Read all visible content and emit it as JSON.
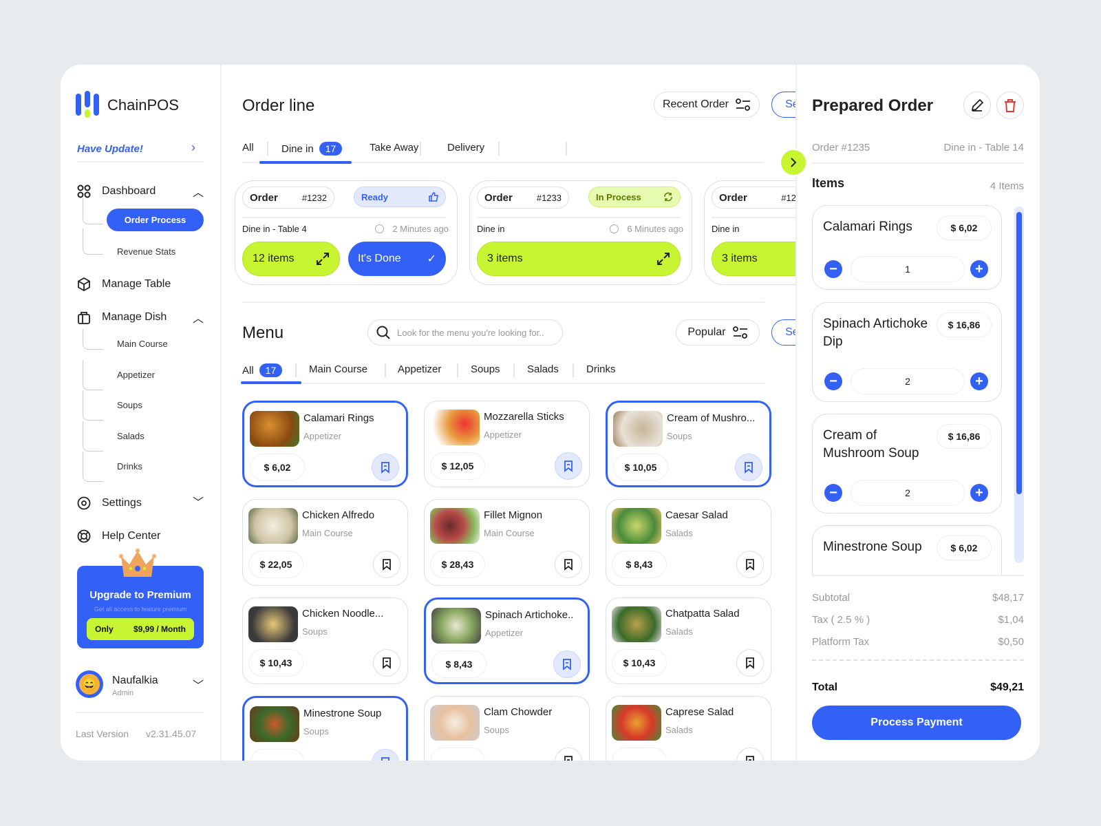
{
  "brand": {
    "name": "ChainPOS",
    "accent": "#3461f5",
    "lime": "#c8f531"
  },
  "sidebar": {
    "update": "Have Update!",
    "dashboard": "Dashboard",
    "dashboard_sub": [
      "Order Process",
      "Revenue Stats"
    ],
    "manage_table": "Manage Table",
    "manage_dish": "Manage Dish",
    "dish_sub": [
      "Main Course",
      "Appetizer",
      "Soups",
      "Salads",
      "Drinks"
    ],
    "settings": "Settings",
    "help": "Help Center",
    "premium": {
      "title": "Upgrade to Premium",
      "subtitle": "Get all access to feature premium",
      "only": "Only",
      "price": "$9,99 / Month"
    },
    "user": {
      "name": "Naufalkia",
      "role": "Admin"
    },
    "version_label": "Last Version",
    "version": "v2.31.45.07"
  },
  "orderline": {
    "title": "Order line",
    "recent": "Recent Order",
    "see_all": "See All",
    "tabs": [
      {
        "label": "All"
      },
      {
        "label": "Dine in",
        "count": "17"
      },
      {
        "label": "Take Away"
      },
      {
        "label": "Delivery"
      }
    ],
    "active_tab": "Dine in",
    "orders": [
      {
        "label": "Order",
        "number": "#1232",
        "status": "Ready",
        "type": "Dine in - Table 4",
        "time": "2 Minutes ago",
        "items": "12 items",
        "done": "It's Done"
      },
      {
        "label": "Order",
        "number": "#1233",
        "status": "In Process",
        "type": "Dine in",
        "time": "6 Minutes ago",
        "items": "3 items"
      },
      {
        "label": "Order",
        "number": "#12",
        "type": "Dine in",
        "items": "3 items"
      }
    ]
  },
  "menu": {
    "title": "Menu",
    "search_placeholder": "Look for the menu you're looking for..",
    "sort": "Popular",
    "see_all": "See All",
    "tabs": [
      {
        "label": "All",
        "count": "17"
      },
      {
        "label": "Main Course"
      },
      {
        "label": "Appetizer"
      },
      {
        "label": "Soups"
      },
      {
        "label": "Salads"
      },
      {
        "label": "Drinks"
      }
    ],
    "items": [
      {
        "name": "Calamari Rings",
        "category": "Appetizer",
        "price": "$ 6,02",
        "selected": true
      },
      {
        "name": "Mozzarella Sticks",
        "category": "Appetizer",
        "price": "$ 12,05",
        "highlight": true
      },
      {
        "name": "Cream of Mushro...",
        "category": "Soups",
        "price": "$ 10,05",
        "selected": true
      },
      {
        "name": "Chicken Alfredo",
        "category": "Main Course",
        "price": "$ 22,05"
      },
      {
        "name": "Fillet Mignon",
        "category": "Main Course",
        "price": "$ 28,43"
      },
      {
        "name": "Caesar Salad",
        "category": "Salads",
        "price": "$ 8,43"
      },
      {
        "name": "Chicken Noodle...",
        "category": "Soups",
        "price": "$ 10,43"
      },
      {
        "name": "Spinach Artichoke..",
        "category": "Appetizer",
        "price": "$ 8,43",
        "selected": true
      },
      {
        "name": "Chatpatta Salad",
        "category": "Salads",
        "price": "$ 10,43"
      },
      {
        "name": "Minestrone Soup",
        "category": "Soups",
        "selected": true
      },
      {
        "name": "Clam Chowder",
        "category": "Soups"
      },
      {
        "name": "Caprese Salad",
        "category": "Salads"
      }
    ]
  },
  "prepared": {
    "title": "Prepared Order",
    "order": "Order #1235",
    "table": "Dine in - Table 14",
    "items_label": "Items",
    "items_count": "4 Items",
    "items": [
      {
        "name": "Calamari Rings",
        "price": "$ 6,02",
        "qty": "1"
      },
      {
        "name": "Spinach Artichoke Dip",
        "price": "$ 16,86",
        "qty": "2"
      },
      {
        "name": "Cream of Mushroom Soup",
        "price": "$ 16,86",
        "qty": "2"
      },
      {
        "name": "Minestrone Soup",
        "price": "$ 6,02"
      }
    ],
    "subtotal_label": "Subtotal",
    "subtotal": "$48,17",
    "tax_label": "Tax ( 2.5 % )",
    "tax": "$1,04",
    "platform_label": "Platform Tax",
    "platform": "$0,50",
    "total_label": "Total",
    "total": "$49,21",
    "pay": "Process Payment"
  }
}
